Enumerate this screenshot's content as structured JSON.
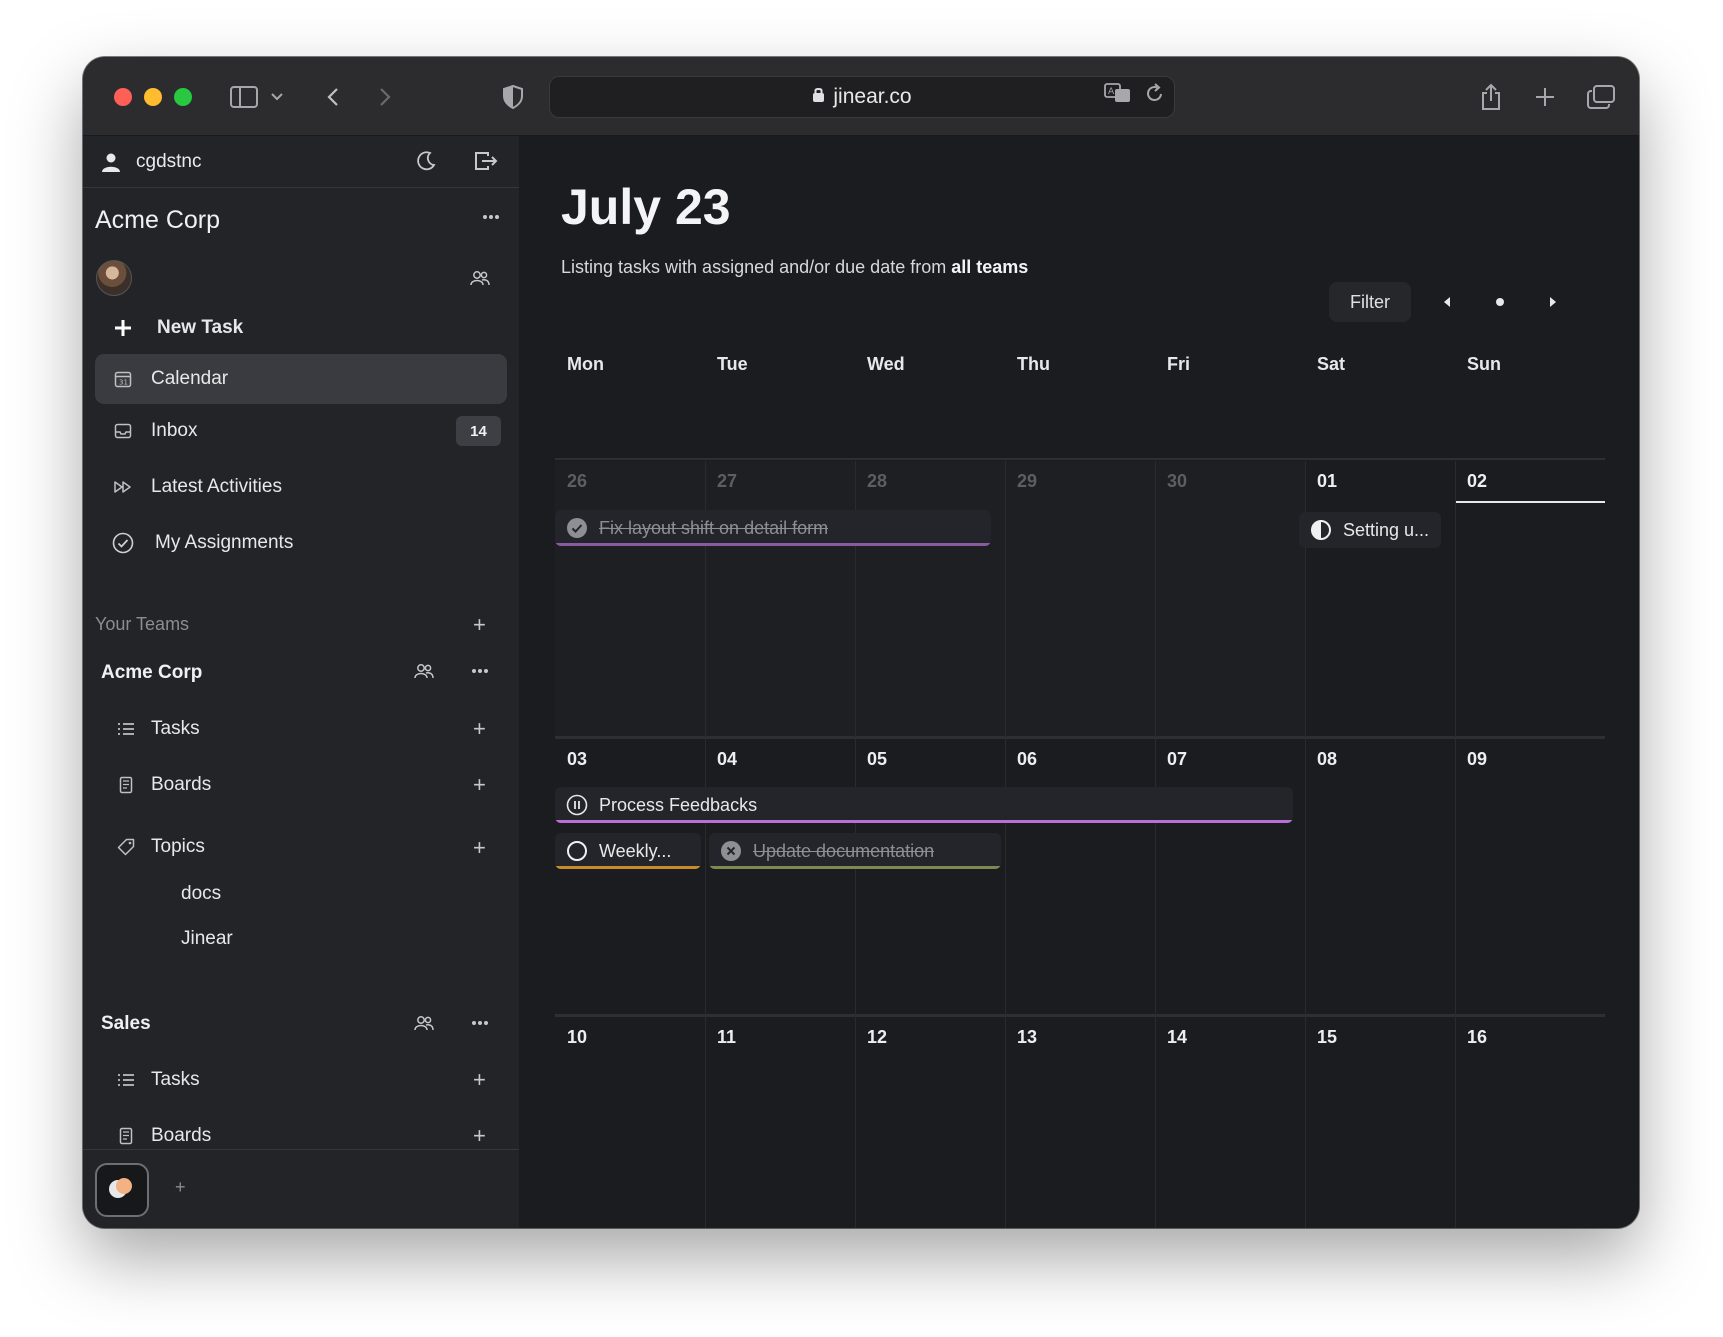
{
  "browser": {
    "url": "jinear.co"
  },
  "sidebar": {
    "username": "cgdstnc",
    "org_name": "Acme Corp",
    "nav": [
      {
        "label": "New Task",
        "icon": "plus-icon"
      },
      {
        "label": "Calendar",
        "icon": "calendar-icon",
        "active": true
      },
      {
        "label": "Inbox",
        "icon": "inbox-icon",
        "badge": "14"
      },
      {
        "label": "Latest Activities",
        "icon": "fast-forward-icon"
      },
      {
        "label": "My Assignments",
        "icon": "check-circle-icon"
      }
    ],
    "your_teams_label": "Your Teams",
    "teams": [
      {
        "name": "Acme Corp",
        "items": [
          {
            "label": "Tasks",
            "icon": "list-icon"
          },
          {
            "label": "Boards",
            "icon": "board-icon"
          },
          {
            "label": "Topics",
            "icon": "tag-icon"
          }
        ],
        "topics": [
          "docs",
          "Jinear"
        ]
      },
      {
        "name": "Sales",
        "items": [
          {
            "label": "Tasks",
            "icon": "list-icon"
          },
          {
            "label": "Boards",
            "icon": "board-icon"
          }
        ]
      }
    ],
    "add_workspace": "+"
  },
  "calendar": {
    "title": "July 23",
    "subtitle_prefix": "Listing tasks with assigned and/or due date from ",
    "subtitle_bold": "all teams",
    "filter_label": "Filter",
    "weekdays": [
      "Mon",
      "Tue",
      "Wed",
      "Thu",
      "Fri",
      "Sat",
      "Sun"
    ],
    "weeks": [
      [
        "26",
        "27",
        "28",
        "29",
        "30",
        "01",
        "02"
      ],
      [
        "03",
        "04",
        "05",
        "06",
        "07",
        "08",
        "09"
      ],
      [
        "10",
        "11",
        "12",
        "13",
        "14",
        "15",
        "16"
      ]
    ],
    "today": "02",
    "tasks": [
      {
        "title": "Fix layout shift on detail form",
        "status": "done",
        "icon": "check-circle-filled-icon",
        "color": "#8a5a9e"
      },
      {
        "title": "Setting u...",
        "status": "in-progress",
        "icon": "half-circle-icon",
        "color": ""
      },
      {
        "title": "Process Feedbacks",
        "status": "paused",
        "icon": "pause-circle-icon",
        "color": "#b86fd6"
      },
      {
        "title": "Weekly...",
        "status": "todo",
        "icon": "empty-circle-icon",
        "color": "#c98a2a"
      },
      {
        "title": "Update documentation",
        "status": "cancelled",
        "icon": "x-circle-icon",
        "color": "#7c8a52"
      }
    ]
  }
}
